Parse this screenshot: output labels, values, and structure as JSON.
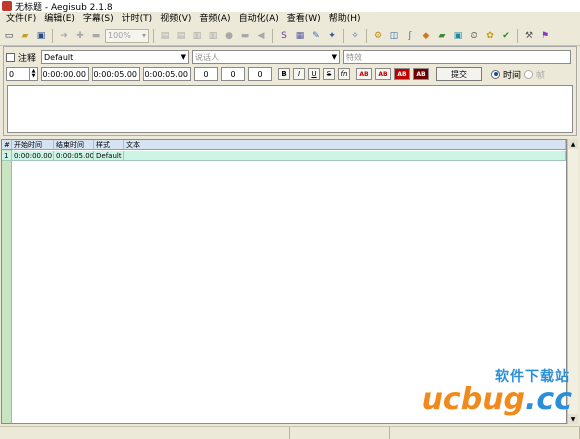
{
  "window": {
    "title": "无标题 - Aegisub 2.1.8"
  },
  "menu": [
    "文件(F)",
    "编辑(E)",
    "字幕(S)",
    "计时(T)",
    "视频(V)",
    "音频(A)",
    "自动化(A)",
    "查看(W)",
    "帮助(H)"
  ],
  "toolbar": {
    "zoom_value": "100%"
  },
  "edit": {
    "comment_label": "注释",
    "style_value": "Default",
    "actor_placeholder": "说话人",
    "effect_placeholder": "特效",
    "layer_value": "0",
    "start_time": "0:00:00.00",
    "end_time": "0:00:05.00",
    "duration": "0:00:05.00",
    "margin_l": "0",
    "margin_r": "0",
    "margin_v": "0",
    "bold_label": "B",
    "italic_label": "I",
    "underline_label": "U",
    "strike_label": "S",
    "font_label": "fn",
    "color_labels": [
      "AB",
      "AB",
      "AB",
      "AB"
    ],
    "commit_label": "提交",
    "radio_time_label": "时间",
    "radio_frame_label": "帧"
  },
  "grid": {
    "headers": {
      "num": "#",
      "start": "开始时间",
      "end": "结束时间",
      "style": "样式",
      "text": "文本"
    },
    "rows": [
      {
        "num": "1",
        "start": "0:00:00.00",
        "end": "0:00:05.00",
        "style": "Default",
        "text": ""
      }
    ]
  },
  "watermark": {
    "top_text": "软件下载站",
    "logo_a": "ucbug",
    "logo_b": ".cc"
  },
  "colors": {
    "grid_header": "#d6e3f2",
    "grid_row": "#ccf5e6",
    "grid_leftbar": "#c8e4c0",
    "watermark_blue": "#2a8fd8",
    "watermark_orange": "#f08a1c"
  }
}
